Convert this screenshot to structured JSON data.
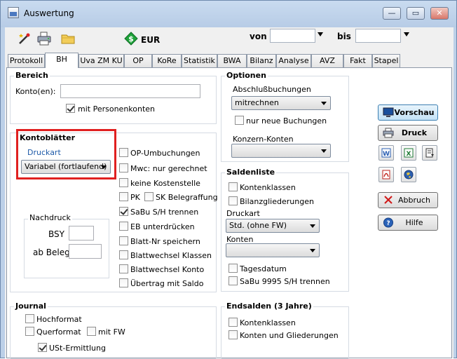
{
  "window": {
    "title": "Auswertung",
    "controls": {
      "minimize": "—",
      "maximize": "▭",
      "close": "✕"
    }
  },
  "toolbar": {
    "currency": "EUR",
    "von_label": "von",
    "bis_label": "bis",
    "von_value": "",
    "bis_value": "",
    "icons": [
      "wand-icon",
      "printer-setup-icon",
      "folder-icon",
      "money-icon"
    ]
  },
  "tabs": [
    {
      "label": "Protokoll"
    },
    {
      "label": "BH"
    },
    {
      "label": "Uva ZM KU"
    },
    {
      "label": "OP"
    },
    {
      "label": "KoRe"
    },
    {
      "label": "Statistik"
    },
    {
      "label": "BWA"
    },
    {
      "label": "Bilanz"
    },
    {
      "label": "Analyse"
    },
    {
      "label": "AVZ"
    },
    {
      "label": "Fakt"
    },
    {
      "label": "Stapel"
    }
  ],
  "bereich": {
    "title": "Bereich",
    "konto_label": "Konto(en):",
    "konto_value": "",
    "personenkonten": {
      "label": "mit Personenkonten",
      "checked": true
    }
  },
  "kontoblaetter": {
    "title": "Kontoblätter",
    "druckart_label": "Druckart",
    "druckart_value": "Variabel (fortlaufend)"
  },
  "options_list": [
    {
      "label": "OP-Umbuchungen",
      "checked": false
    },
    {
      "label": "Mwc: nur gerechnet",
      "checked": false
    },
    {
      "label": "keine Kostenstelle",
      "checked": false
    },
    {
      "label": "PK",
      "checked": false
    },
    {
      "label": "SK Belegraffung",
      "checked": false
    },
    {
      "label": "SaBu S/H trennen",
      "checked": true
    },
    {
      "label": "EB unterdrücken",
      "checked": false
    },
    {
      "label": "Blatt-Nr speichern",
      "checked": false
    },
    {
      "label": "Blattwechsel Klassen",
      "checked": false
    },
    {
      "label": "Blattwechsel Konto",
      "checked": false
    },
    {
      "label": "Übertrag mit Saldo",
      "checked": false
    }
  ],
  "nachdruck": {
    "title": "Nachdruck",
    "bsy_label": "BSY",
    "bsy_value": "",
    "beleg_label": "ab Beleg",
    "beleg_value": ""
  },
  "journal": {
    "title": "Journal",
    "hochformat": {
      "label": "Hochformat",
      "checked": false
    },
    "querformat": {
      "label": "Querformat",
      "checked": false
    },
    "mit_fw": {
      "label": "mit FW",
      "checked": false
    },
    "ust": {
      "label": "USt-Ermittlung",
      "checked": true
    }
  },
  "optionen": {
    "title": "Optionen",
    "abschluss_label": "Abschlußbuchungen",
    "abschluss_value": "mitrechnen",
    "nur_neue": {
      "label": "nur neue Buchungen",
      "checked": false
    },
    "konzern_label": "Konzern-Konten",
    "konzern_value": ""
  },
  "saldenliste": {
    "title": "Saldenliste",
    "kontenklassen": {
      "label": "Kontenklassen",
      "checked": false
    },
    "bilanzgliederungen": {
      "label": "Bilanzgliederungen",
      "checked": false
    },
    "druckart_label": "Druckart",
    "druckart_value": "Std. (ohne FW)",
    "konten_label": "Konten",
    "konten_value": "",
    "tagesdatum": {
      "label": "Tagesdatum",
      "checked": false
    },
    "sabu9995": {
      "label": "SaBu 9995 S/H trennen",
      "checked": false
    }
  },
  "endsalden": {
    "title": "Endsalden (3 Jahre)",
    "kontenklassen": {
      "label": "Kontenklassen",
      "checked": false
    },
    "konten_gliederungen": {
      "label": "Konten und Gliederungen",
      "checked": false
    }
  },
  "actions": {
    "vorschau": "Vorschau",
    "druck": "Druck",
    "abbruch": "Abbruch",
    "hilfe": "Hilfe",
    "export_icons": [
      "word-icon",
      "excel-icon",
      "export-icon",
      "pdf-icon",
      "globe-icon"
    ]
  },
  "colors": {
    "highlight": "#e02020",
    "accent": "#1e5aa8"
  }
}
